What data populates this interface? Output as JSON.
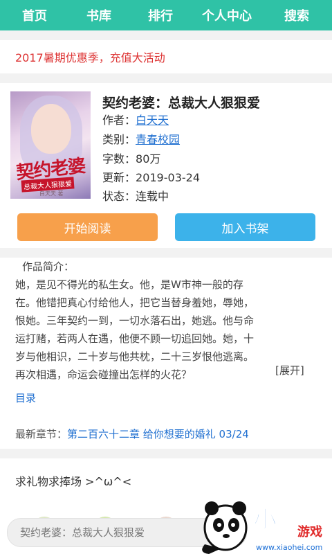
{
  "nav": {
    "items": [
      "首页",
      "书库",
      "排行",
      "个人中心",
      "搜索"
    ]
  },
  "promo": {
    "text": "2017暑期优惠季，充值大活动"
  },
  "book": {
    "title": "契约老婆：总裁大人狠狠爱",
    "author_label": "作者：",
    "author": "白天天",
    "category_label": "类别：",
    "category": "青春校园",
    "words_label": "字数：",
    "words": "80万",
    "updated_label": "更新：",
    "updated": "2019-03-24",
    "status_label": "状态：",
    "status": "连载中",
    "cover": {
      "title": "契约老婆",
      "subtitle": "总裁大人狠狠爱",
      "author": "白天天 著"
    }
  },
  "actions": {
    "read_label": "开始阅读",
    "shelf_label": "加入书架"
  },
  "intro": {
    "label": "作品简介：",
    "lines": [
      "她，是见不得光的私生女。他，是W市神一般的存",
      "在。他错把真心付给他人，把它当替身羞她，辱她，",
      "恨她。三年契约一到，一切水落石出，她逃。他与命",
      "运打赌，若两人在遇，他便不顾一切追回她。她，十",
      "岁与他相识，二十岁与他共枕，二十三岁恨他逃离。",
      "再次相遇，命运会碰撞出怎样的火花？"
    ],
    "expand_label": "[展开]",
    "toc_label": "目录",
    "latest_label": "最新章节：",
    "latest_chapter": "第二百六十二章 给你想要的婚礼 03/24"
  },
  "gift": {
    "title": "求礼物求捧场 >^ω^<"
  },
  "search": {
    "placeholder": "契约老婆：总裁大人狠狠爱"
  },
  "watermark": {
    "logo_text": "小黑",
    "logo_sub": "游戏",
    "site": "www.xiaohei.com"
  },
  "colors": {
    "nav": "#2fc2a6",
    "promo_text": "#dd3333",
    "read_button": "#f7a04b",
    "shelf_button": "#3cb2ea",
    "link": "#1f6fd0"
  }
}
